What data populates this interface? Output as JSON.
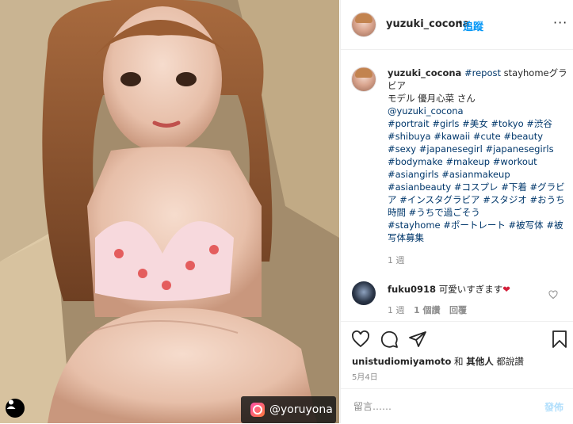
{
  "header": {
    "username": "yuzuki_cocona",
    "separator": "•",
    "follow_label": "追蹤",
    "more_label": "···"
  },
  "photo": {
    "tag_label": "@yoruyona"
  },
  "caption": {
    "username": "yuzuki_cocona",
    "segments": [
      {
        "t": "#repost",
        "tag": true
      },
      {
        "t": " stayhomeグラビア\nモデル 優月心菜 さん\n",
        "tag": false
      },
      {
        "t": "@yuzuki_cocona",
        "tag": true
      },
      {
        "t": "\n",
        "tag": false
      },
      {
        "t": "#portrait",
        "tag": true
      },
      {
        "t": " ",
        "tag": false
      },
      {
        "t": "#girls",
        "tag": true
      },
      {
        "t": " ",
        "tag": false
      },
      {
        "t": "#美女",
        "tag": true
      },
      {
        "t": " ",
        "tag": false
      },
      {
        "t": "#tokyo",
        "tag": true
      },
      {
        "t": " ",
        "tag": false
      },
      {
        "t": "#渋谷",
        "tag": true
      },
      {
        "t": "\n",
        "tag": false
      },
      {
        "t": "#shibuya",
        "tag": true
      },
      {
        "t": " ",
        "tag": false
      },
      {
        "t": "#kawaii",
        "tag": true
      },
      {
        "t": " ",
        "tag": false
      },
      {
        "t": "#cute",
        "tag": true
      },
      {
        "t": " ",
        "tag": false
      },
      {
        "t": "#beauty",
        "tag": true
      },
      {
        "t": "\n",
        "tag": false
      },
      {
        "t": "#sexy",
        "tag": true
      },
      {
        "t": " ",
        "tag": false
      },
      {
        "t": "#japanesegirl",
        "tag": true
      },
      {
        "t": " ",
        "tag": false
      },
      {
        "t": "#japanesegirls",
        "tag": true
      },
      {
        "t": "\n",
        "tag": false
      },
      {
        "t": "#bodymake",
        "tag": true
      },
      {
        "t": " ",
        "tag": false
      },
      {
        "t": "#makeup",
        "tag": true
      },
      {
        "t": " ",
        "tag": false
      },
      {
        "t": "#workout",
        "tag": true
      },
      {
        "t": "\n",
        "tag": false
      },
      {
        "t": "#asiangirls",
        "tag": true
      },
      {
        "t": " ",
        "tag": false
      },
      {
        "t": "#asianmakeup",
        "tag": true
      },
      {
        "t": "\n",
        "tag": false
      },
      {
        "t": "#asianbeauty",
        "tag": true
      },
      {
        "t": " ",
        "tag": false
      },
      {
        "t": "#コスプレ",
        "tag": true
      },
      {
        "t": " ",
        "tag": false
      },
      {
        "t": "#下着",
        "tag": true
      },
      {
        "t": " ",
        "tag": false
      },
      {
        "t": "#グラビア",
        "tag": true
      },
      {
        "t": " ",
        "tag": false
      },
      {
        "t": "#インスタグラビア",
        "tag": true
      },
      {
        "t": " ",
        "tag": false
      },
      {
        "t": "#スタジオ",
        "tag": true
      },
      {
        "t": " ",
        "tag": false
      },
      {
        "t": "#おうち時間",
        "tag": true
      },
      {
        "t": " ",
        "tag": false
      },
      {
        "t": "#うちで過ごそう",
        "tag": true
      },
      {
        "t": "\n",
        "tag": false
      },
      {
        "t": "#stayhome",
        "tag": true
      },
      {
        "t": " ",
        "tag": false
      },
      {
        "t": "#ポートレート",
        "tag": true
      },
      {
        "t": " ",
        "tag": false
      },
      {
        "t": "#被写体",
        "tag": true
      },
      {
        "t": " ",
        "tag": false
      },
      {
        "t": "#被写体募集",
        "tag": true
      }
    ],
    "time": "1 週"
  },
  "comment": {
    "username": "fuku0918",
    "text": "可愛いすぎます",
    "emoji": "❤",
    "time": "1 週",
    "likes": "1 個讚",
    "reply": "回覆"
  },
  "likes": {
    "user": "unistudiomiyamoto",
    "and": "和",
    "others": "其他人",
    "suffix": "都說讚"
  },
  "date": "5月4日",
  "comment_box": {
    "placeholder": "留言……",
    "post_label": "發佈"
  },
  "colors": {
    "accent": "#0095f6",
    "hashtag": "#00376b",
    "post_disabled": "#b2dffc",
    "muted": "#8e8e8e"
  },
  "icons": [
    "more-icon",
    "heart-icon",
    "comment-icon",
    "share-icon",
    "bookmark-icon",
    "user-tag-icon",
    "app-logo-icon"
  ]
}
